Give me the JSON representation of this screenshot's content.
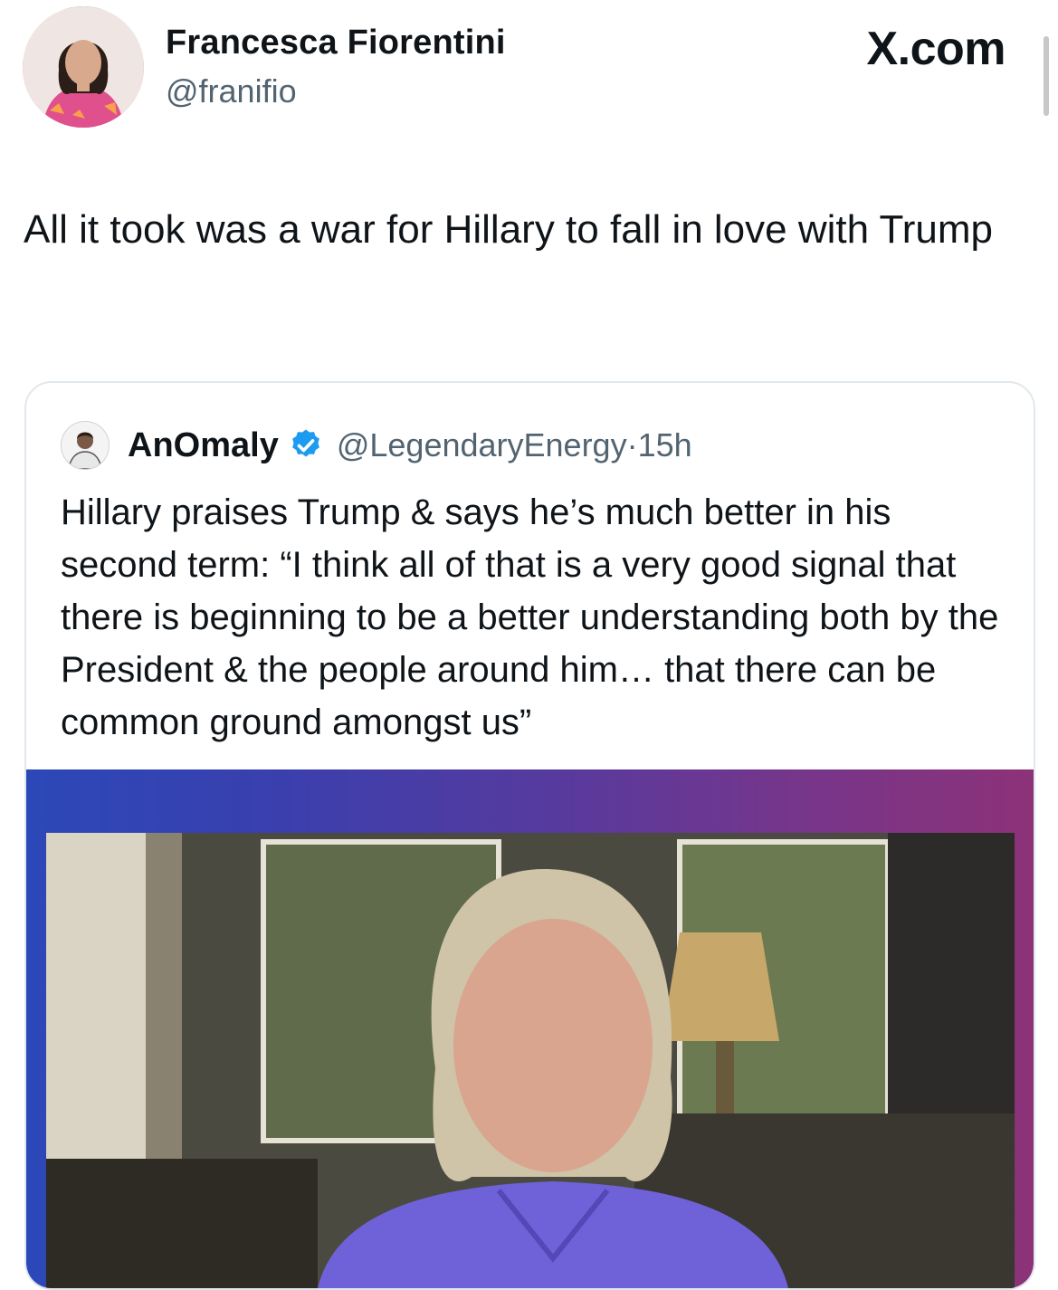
{
  "author": {
    "display_name": "Francesca Fiorentini",
    "handle": "@franifio"
  },
  "brand": "X.com",
  "tweet": {
    "text": "All it took was a war for Hillary to fall in love with Trump"
  },
  "quoted": {
    "display_name": "AnOmaly",
    "handle": "@LegendaryEnergy",
    "separator": "·",
    "time": "15h",
    "text": "Hillary praises Trump & says he’s much better in his second term: “I think all of that is a very good signal that there is beginning to be a better understanding both by the President & the people around him… that there can be common ground amongst us”",
    "verified_icon": "verified-badge-icon",
    "media_icon": "video-thumbnail"
  },
  "colors": {
    "text": "#0f1419",
    "secondary": "#536471",
    "verified": "#1d9bf0",
    "card_border": "#e1e8ed"
  }
}
